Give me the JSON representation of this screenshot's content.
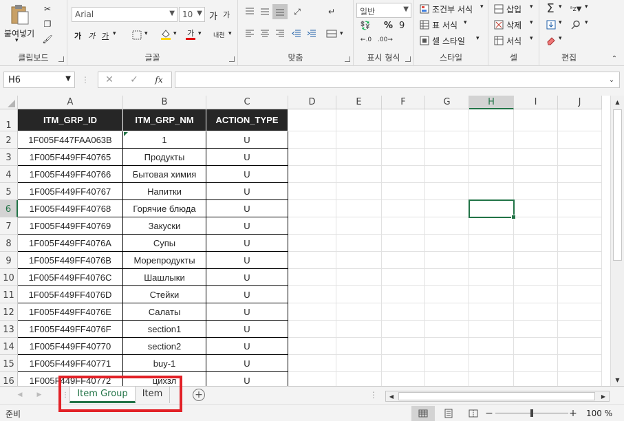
{
  "ribbon": {
    "clipboard": {
      "paste_label": "붙여넣기",
      "group_label": "클립보드"
    },
    "font": {
      "font_name": "Arial",
      "font_size": "10",
      "group_label": "글꼴",
      "bold": "가",
      "italic": "가",
      "underline": "가",
      "grow": "가",
      "shrink": "가",
      "phonetic": "내천"
    },
    "alignment": {
      "group_label": "맞춤"
    },
    "number": {
      "format_value": "일반",
      "percent": "%",
      "comma": "9",
      "group_label": "표시 형식"
    },
    "styles": {
      "conditional": "조건부 서식",
      "table": "표 서식",
      "cell": "셀 스타일",
      "group_label": "스타일"
    },
    "cells": {
      "insert": "삽입",
      "delete": "삭제",
      "format": "서식",
      "group_label": "셀"
    },
    "editing": {
      "group_label": "편집"
    }
  },
  "formula_bar": {
    "name_box": "H6",
    "fx": "fx",
    "formula": ""
  },
  "columns": [
    "A",
    "B",
    "C",
    "D",
    "E",
    "F",
    "G",
    "H",
    "I",
    "J"
  ],
  "selected_column": "H",
  "selected_row": "6",
  "table": {
    "headers": [
      "ITM_GRP_ID",
      "ITM_GRP_NM",
      "ACTION_TYPE"
    ],
    "rows": [
      [
        "1F005F447FAA063B",
        "1",
        "U"
      ],
      [
        "1F005F449FF40765",
        "Продукты",
        "U"
      ],
      [
        "1F005F449FF40766",
        "Бытовая химия",
        "U"
      ],
      [
        "1F005F449FF40767",
        "Напитки",
        "U"
      ],
      [
        "1F005F449FF40768",
        "Горячие блюда",
        "U"
      ],
      [
        "1F005F449FF40769",
        "Закуски",
        "U"
      ],
      [
        "1F005F449FF4076A",
        "Супы",
        "U"
      ],
      [
        "1F005F449FF4076B",
        "Морепродукты",
        "U"
      ],
      [
        "1F005F449FF4076C",
        "Шашлыки",
        "U"
      ],
      [
        "1F005F449FF4076D",
        "Стейки",
        "U"
      ],
      [
        "1F005F449FF4076E",
        "Салаты",
        "U"
      ],
      [
        "1F005F449FF4076F",
        "section1",
        "U"
      ],
      [
        "1F005F449FF40770",
        "section2",
        "U"
      ],
      [
        "1F005F449FF40771",
        "buy-1",
        "U"
      ],
      [
        "1F005F449FF40772",
        "цихзл",
        "U"
      ]
    ]
  },
  "row_numbers": [
    "1",
    "2",
    "3",
    "4",
    "5",
    "6",
    "7",
    "8",
    "9",
    "10",
    "11",
    "12",
    "13",
    "14",
    "15",
    "16"
  ],
  "sheet_tabs": [
    {
      "label": "Item Group",
      "active": true
    },
    {
      "label": "Item",
      "active": false
    }
  ],
  "status": {
    "mode": "준비",
    "zoom": "100 %"
  },
  "colors": {
    "accent": "#217346",
    "header_fill": "#262626",
    "highlight": "#e22127"
  },
  "icons": [
    "paste-icon",
    "cut-icon",
    "copy-icon",
    "format-painter-icon",
    "sum-icon",
    "sort-filter-icon",
    "find-icon",
    "clear-icon",
    "fx-icon",
    "add-sheet-icon"
  ]
}
